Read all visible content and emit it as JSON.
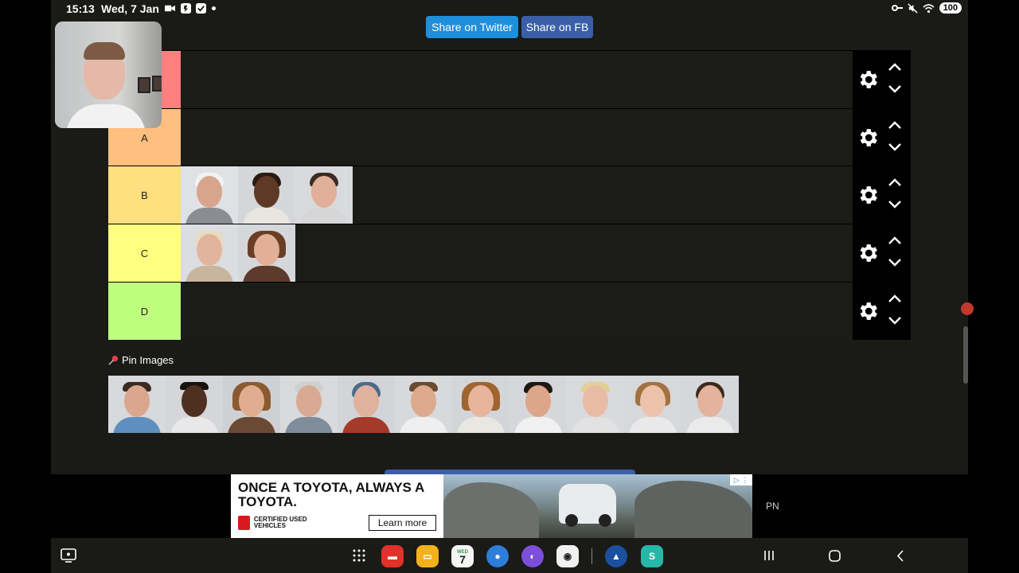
{
  "status_bar": {
    "time": "15:13",
    "date": "Wed, 7 Jan",
    "battery": "100"
  },
  "share": {
    "twitter_label": "Share on Twitter",
    "fb_label": "Share on FB"
  },
  "tiers": [
    {
      "label": "",
      "color": "#ff7f7f"
    },
    {
      "label": "A",
      "color": "#ffbf7f"
    },
    {
      "label": "B",
      "color": "#ffdf7f"
    },
    {
      "label": "C",
      "color": "#ffff7f"
    },
    {
      "label": "D",
      "color": "#bfff7f"
    }
  ],
  "pin_images": {
    "label": "Pin Images"
  },
  "ad": {
    "headline": "ONCE A TOYOTA, ALWAYS A TOYOTA.",
    "certified": "CERTIFIED USED VEHICLES",
    "cta": "Learn more"
  },
  "side_text": "PN",
  "dock": {
    "calendar_day": "7",
    "calendar_month": "WED"
  },
  "icons": [
    "video-icon",
    "gear-icon",
    "chevron-up-icon",
    "chevron-down-icon",
    "pin-icon",
    "apps-grid-icon",
    "recents-icon",
    "home-icon",
    "back-icon"
  ]
}
